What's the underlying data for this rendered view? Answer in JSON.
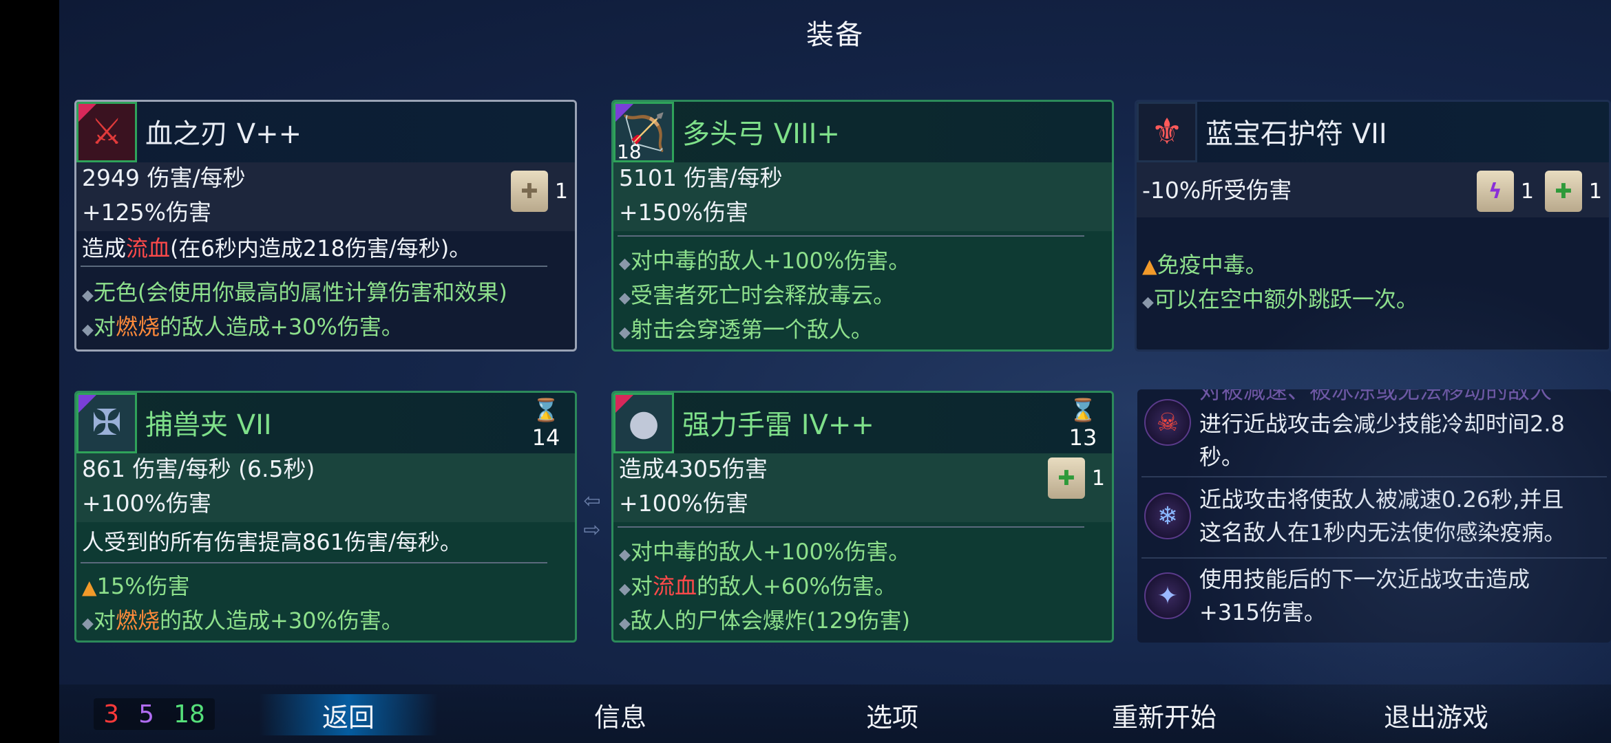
{
  "screen_title": "装备",
  "cards": {
    "blood_blade": {
      "name": "血之刃 V++",
      "icon": "blood-blade-icon",
      "stat1": "2949 伤害/每秒",
      "stat2": "+125%伤害",
      "scroll_count": "1",
      "desc_a": "造成",
      "desc_b": "流血",
      "desc_c": "(在6秒内造成218伤害/每秒)。",
      "b1": "无色(会使用你最高的属性计算伤害和效果)",
      "b2_a": "对",
      "b2_b": "燃烧",
      "b2_c": "的敌人造成+30%伤害。"
    },
    "multi_bow": {
      "name": "多头弓 VIII+",
      "icon": "bow-icon",
      "icon_number": "18",
      "stat1": "5101 伤害/每秒",
      "stat2": "+150%伤害",
      "b1_a": "对",
      "b1_b": "中毒",
      "b1_c": "的敌人+100%伤害。",
      "b2_a": "受害者死亡时会释放",
      "b2_b": "毒云",
      "b2_c": "。",
      "b3": "射击会穿透第一个敌人。"
    },
    "sapphire_amulet": {
      "name": "蓝宝石护符 VII",
      "icon": "amulet-icon",
      "stat1": "-10%所受伤害",
      "scroll1_count": "1",
      "scroll2_count": "1",
      "b1_a": "免疫",
      "b1_b": "中毒",
      "b1_c": "。",
      "b2": "可以在空中额外跳跃一次。"
    },
    "bear_trap": {
      "name": "捕兽夹 VII",
      "icon": "bear-trap-icon",
      "timer": "14",
      "stat1": "861 伤害/每秒 (6.5秒)",
      "stat2": "+100%伤害",
      "desc": "人受到的所有伤害提高861伤害/每秒。",
      "b1": "15%伤害",
      "b2_a": "对",
      "b2_b": "燃烧",
      "b2_c": "的敌人造成+30%伤害。"
    },
    "grenade": {
      "name": "强力手雷 IV++",
      "icon": "grenade-icon",
      "timer": "13",
      "stat1": "造成4305伤害",
      "stat2": "+100%伤害",
      "scroll_count": "1",
      "b1_a": "对",
      "b1_b": "中毒",
      "b1_c": "的敌人+100%伤害。",
      "b2_a": "对",
      "b2_b": "流血",
      "b2_c": "的敌人+60%伤害。",
      "b3": "敌人的尸体会爆炸(129伤害)"
    }
  },
  "talents": [
    {
      "icon": "fire-skull-icon",
      "line0": "对被减速、被冰冻或无法移动的敌人",
      "line1": "进行近战攻击会减少技能冷却时间2.8",
      "line2": "秒。"
    },
    {
      "icon": "ice-scythe-icon",
      "line1": "近战攻击将使敌人被减速0.26秒,并且",
      "line2": "这名敌人在1秒内无法使你感染疫病。"
    },
    {
      "icon": "scroll-rune-icon",
      "line1": "使用技能后的下一次近战攻击造成",
      "line2": "+315伤害。"
    }
  ],
  "counters": {
    "red": "3",
    "purple": "5",
    "green": "18"
  },
  "nav": {
    "back": "返回",
    "info": "信息",
    "options": "选项",
    "restart": "重新开始",
    "quit": "退出游戏"
  }
}
